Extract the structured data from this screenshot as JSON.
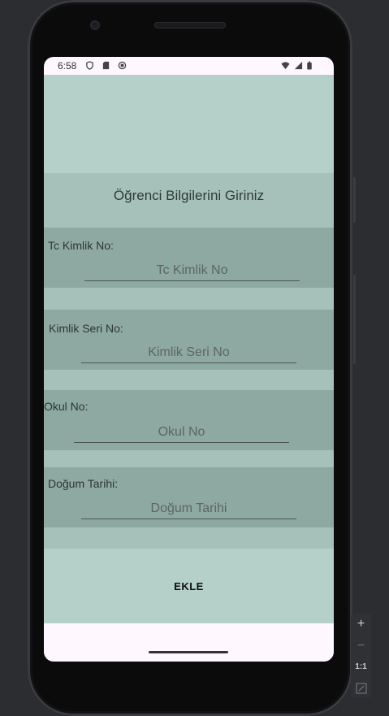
{
  "status_bar": {
    "time": "6:58",
    "left_icons": [
      "shield-icon",
      "sd-card-icon",
      "android-icon"
    ],
    "right_icons": [
      "wifi-icon",
      "signal-icon",
      "battery-icon"
    ]
  },
  "form": {
    "title": "Öğrenci Bilgilerini Giriniz",
    "fields": [
      {
        "label": "Tc Kimlik No:",
        "placeholder": "Tc Kimlik No"
      },
      {
        "label": "Kimlik Seri No:",
        "placeholder": "Kimlik Seri No"
      },
      {
        "label": "Okul No:",
        "placeholder": "Okul No"
      },
      {
        "label": "Doğum Tarihi:",
        "placeholder": "Doğum Tarihi"
      }
    ],
    "submit_label": "EKLE"
  },
  "emulator_controls": {
    "zoom_in": "+",
    "zoom_out": "−",
    "actual_size": "1:1"
  },
  "colors": {
    "app_background": "#b5d0c9",
    "title_band": "#a6c0ba",
    "field_band": "#8ea8a2",
    "system_bars": "#fef7fe"
  }
}
